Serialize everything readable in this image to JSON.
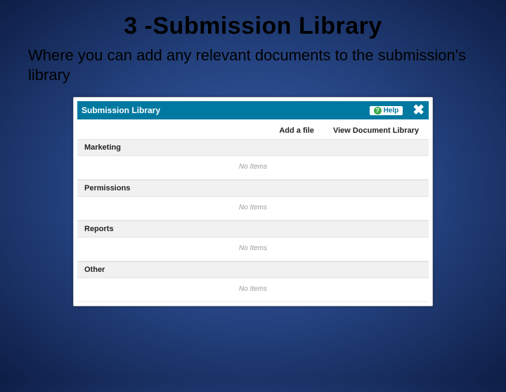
{
  "slide": {
    "title": "3 -Submission Library",
    "subtitle": "Where you can add any relevant documents to the submission's library"
  },
  "panel": {
    "header_title": "Submission Library",
    "help_label": "Help",
    "close_glyph": "✖",
    "actions": {
      "add_file": "Add a file",
      "view_library": "View Document Library"
    },
    "sections": {
      "s0": {
        "title": "Marketing",
        "empty": "No Items"
      },
      "s1": {
        "title": "Permissions",
        "empty": "No Items"
      },
      "s2": {
        "title": "Reports",
        "empty": "No Items"
      },
      "s3": {
        "title": "Other",
        "empty": "No Items"
      }
    }
  }
}
